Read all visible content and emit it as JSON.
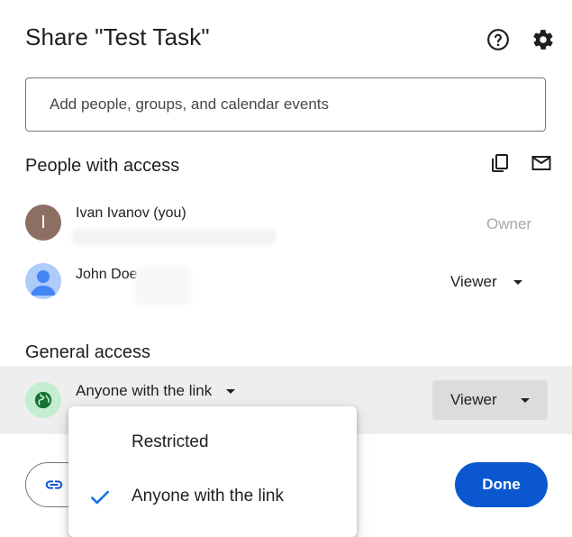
{
  "dialog": {
    "title": "Share \"Test Task\"",
    "icons": {
      "help": "help-circle-icon",
      "settings": "gear-icon"
    }
  },
  "search": {
    "placeholder": "Add people, groups, and calendar events",
    "value": ""
  },
  "people_section": {
    "heading": "People with access",
    "icons": {
      "copy": "copy-icon",
      "email": "mail-icon"
    },
    "people": [
      {
        "name": "Ivan Ivanov (you)",
        "avatar_letter": "I",
        "avatar_color": "#8d6e63",
        "role": "Owner"
      },
      {
        "name": "John Doe",
        "avatar_color": "#aecbfa",
        "role": "Viewer"
      }
    ]
  },
  "general_access": {
    "heading": "General access",
    "selected": "Anyone with the link",
    "role": "Viewer",
    "menu": [
      {
        "label": "Restricted",
        "checked": false
      },
      {
        "label": "Anyone with the link",
        "checked": true
      }
    ]
  },
  "footer": {
    "copy_link_icon": "link-icon",
    "done_label": "Done"
  },
  "colors": {
    "accent": "#0b57d0",
    "check": "#1a73e8",
    "globe_bg": "#c4eed0",
    "globe": "#137333"
  }
}
